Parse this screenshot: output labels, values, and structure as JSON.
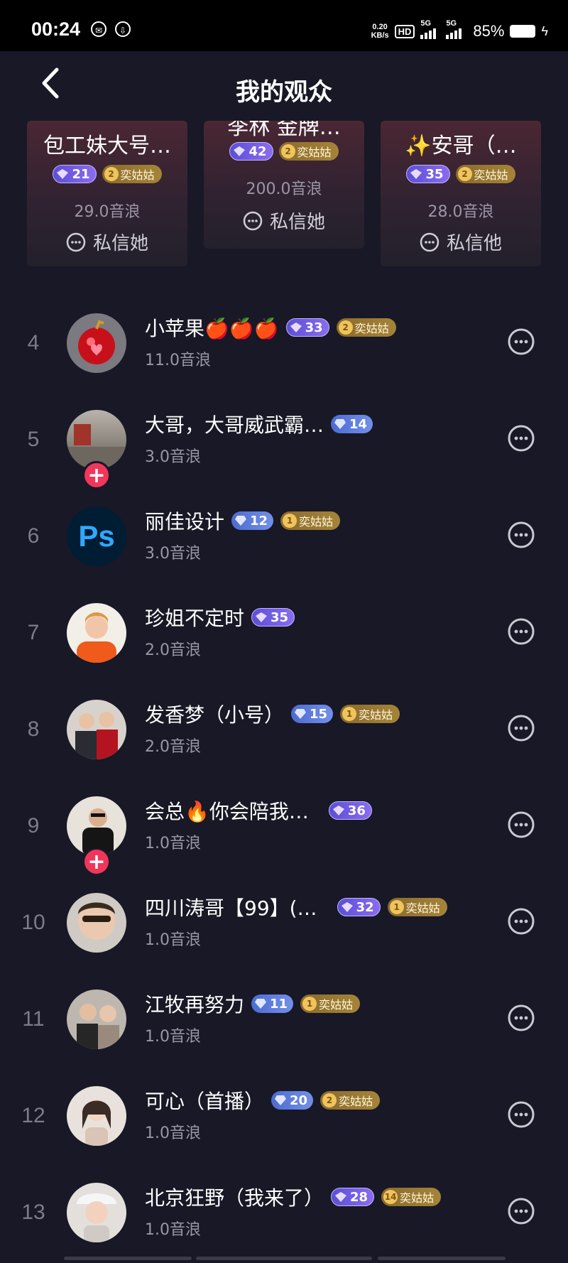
{
  "status_bar": {
    "time": "00:24",
    "net_speed_value": "0.20",
    "net_speed_unit": "KB/s",
    "hd": "HD",
    "net1": "5G",
    "net2": "5G",
    "battery": "85%"
  },
  "header": {
    "title": "我的观众",
    "back_icon": "chevron-left-icon"
  },
  "podium": [
    {
      "name": "包工妹大号…",
      "level": "21",
      "fan_level": "2",
      "fan_label": "奕姑姑",
      "wave": "29.0音浪",
      "message": "私信她"
    },
    {
      "name": "李林 金牌…",
      "level": "42",
      "fan_level": "2",
      "fan_label": "奕姑姑",
      "wave": "200.0音浪",
      "message": "私信她"
    },
    {
      "name": "✨安哥（…",
      "level": "35",
      "fan_level": "2",
      "fan_label": "奕姑姑",
      "wave": "28.0音浪",
      "message": "私信他"
    }
  ],
  "list": [
    {
      "rank": "4",
      "name": "小苹果🍎🍎🍎",
      "level": "33",
      "level_color": "purple",
      "fan_level": "2",
      "fan_label": "奕姑姑",
      "wave": "11.0音浪"
    },
    {
      "rank": "5",
      "name": "大哥，大哥威武霸…",
      "level": "14",
      "level_color": "blue",
      "wave": "3.0音浪",
      "follow": true
    },
    {
      "rank": "6",
      "name": "丽佳设计",
      "level": "12",
      "level_color": "blue",
      "fan_level": "1",
      "fan_label": "奕姑姑",
      "wave": "3.0音浪"
    },
    {
      "rank": "7",
      "name": "珍姐不定时",
      "level": "35",
      "level_color": "purple",
      "wave": "2.0音浪"
    },
    {
      "rank": "8",
      "name": "发香梦（小号）",
      "level": "15",
      "level_color": "blue",
      "fan_level": "1",
      "fan_label": "奕姑姑",
      "wave": "2.0音浪"
    },
    {
      "rank": "9",
      "name": "会总🔥你会陪我…",
      "level": "36",
      "level_color": "purple",
      "wave": "1.0音浪",
      "follow": true
    },
    {
      "rank": "10",
      "name": "四川涛哥【99】(…",
      "level": "32",
      "level_color": "purple",
      "fan_level": "1",
      "fan_label": "奕姑姑",
      "wave": "1.0音浪"
    },
    {
      "rank": "11",
      "name": "江牧再努力",
      "level": "11",
      "level_color": "blue",
      "fan_level": "1",
      "fan_label": "奕姑姑",
      "wave": "1.0音浪"
    },
    {
      "rank": "12",
      "name": "可心（首播）",
      "level": "20",
      "level_color": "blue",
      "fan_level": "2",
      "fan_label": "奕姑姑",
      "wave": "1.0音浪"
    },
    {
      "rank": "13",
      "name": "北京狂野（我来了）",
      "level": "28",
      "level_color": "purple",
      "fan_level": "14",
      "fan_label": "奕姑姑",
      "wave": "1.0音浪"
    }
  ],
  "avatar_icons": [
    "apple-avatar",
    "person-avatar",
    "ps-logo-avatar",
    "person-avatar",
    "person-avatar",
    "person-avatar",
    "person-avatar",
    "person-avatar",
    "person-avatar",
    "person-avatar"
  ],
  "ps_logo_text": "Ps",
  "plus_label": "+",
  "colors": {
    "background": "#181826",
    "accent_red": "#f0365a",
    "fan_gold": "#a58439",
    "level_purple": "#6c5ce0",
    "level_blue": "#5a7ad8"
  }
}
